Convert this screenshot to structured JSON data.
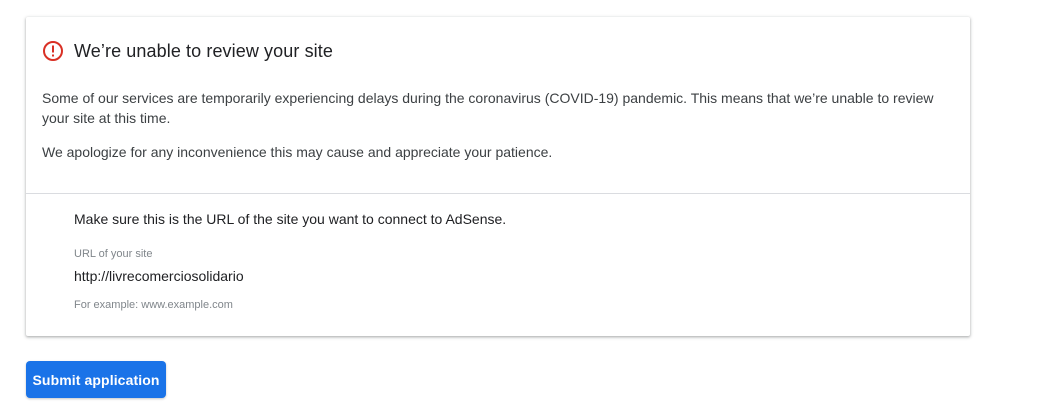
{
  "alert": {
    "title": "We’re unable to review your site",
    "icon": "alert-circle-icon",
    "icon_color": "#d93025",
    "paragraphs": [
      "Some of our services are temporarily experiencing delays during the coronavirus (COVID-19) pandemic. This means that we’re unable to review your site at this time.",
      "We apologize for any inconvenience this may cause and appreciate your patience."
    ]
  },
  "site": {
    "instruction": "Make sure this is the URL of the site you want to connect to AdSense.",
    "url_label": "URL of your site",
    "url_value": "http://livrecomerciosolidario",
    "hint": "For example: www.example.com"
  },
  "actions": {
    "submit_label": "Submit application",
    "submit_color": "#1a73e8"
  }
}
